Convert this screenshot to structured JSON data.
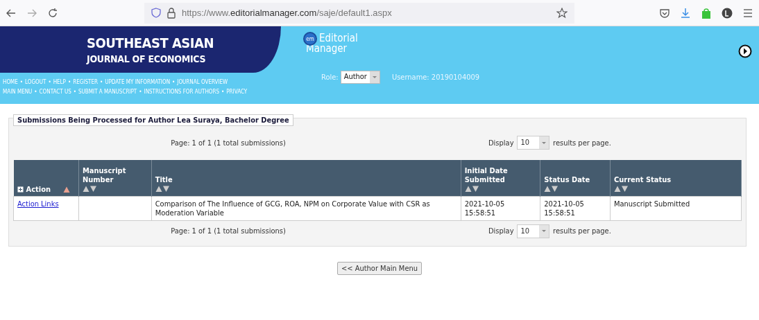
{
  "browser": {
    "url": "https://www.**editorialmanager.com**/saje/default1.aspx"
  },
  "header": {
    "journal_title": [
      "SOUTHEAST ASIAN",
      "JOURNAL OF ECONOMICS"
    ],
    "logo_badge": "em",
    "logo_text": [
      "Editorial",
      "Manager"
    ],
    "role_label": "Role:",
    "role_value": "Author",
    "username": "Username: 20190104009",
    "separator": "•",
    "nav_lines": [
      [
        "HOME",
        "LOGOUT",
        "HELP",
        "REGISTER",
        "UPDATE MY INFORMATION",
        "JOURNAL OVERVIEW"
      ],
      [
        "MAIN MENU",
        "CONTACT US",
        "SUBMIT A MANUSCRIPT",
        "INSTRUCTIONS FOR AUTHORS",
        "PRIVACY"
      ]
    ]
  },
  "submissions": {
    "legend": "Submissions Being Processed for Author Lea Suraya, Bachelor Degree",
    "pagers": [
      {
        "page_text": "Page: 1 of 1 (1 total submissions)",
        "display_label": "Display",
        "display_value": "10",
        "suffix": "results per page."
      },
      {
        "page_text": "Page: 1 of 1 (1 total submissions)",
        "display_label": "Display",
        "display_value": "10",
        "suffix": "results per page."
      }
    ],
    "columns": [
      {
        "label": "Action",
        "sorted": true
      },
      {
        "label": "Manuscript Number",
        "sorted": false
      },
      {
        "label": "Title",
        "sorted": false
      },
      {
        "label": "Initial Date Submitted",
        "sorted": false
      },
      {
        "label": "Status Date",
        "sorted": false
      },
      {
        "label": "Current Status",
        "sorted": false
      }
    ],
    "rows": [
      {
        "cells": [
          "Action Links",
          "",
          "Comparison of The Influence of GCG, ROA, NPM on Corporate Value with CSR as Moderation Variable",
          "2021-10-05 15:58:51",
          "2021-10-05 15:58:51",
          "Manuscript Submitted"
        ]
      }
    ]
  },
  "footer_button": "<< Author Main Menu"
}
